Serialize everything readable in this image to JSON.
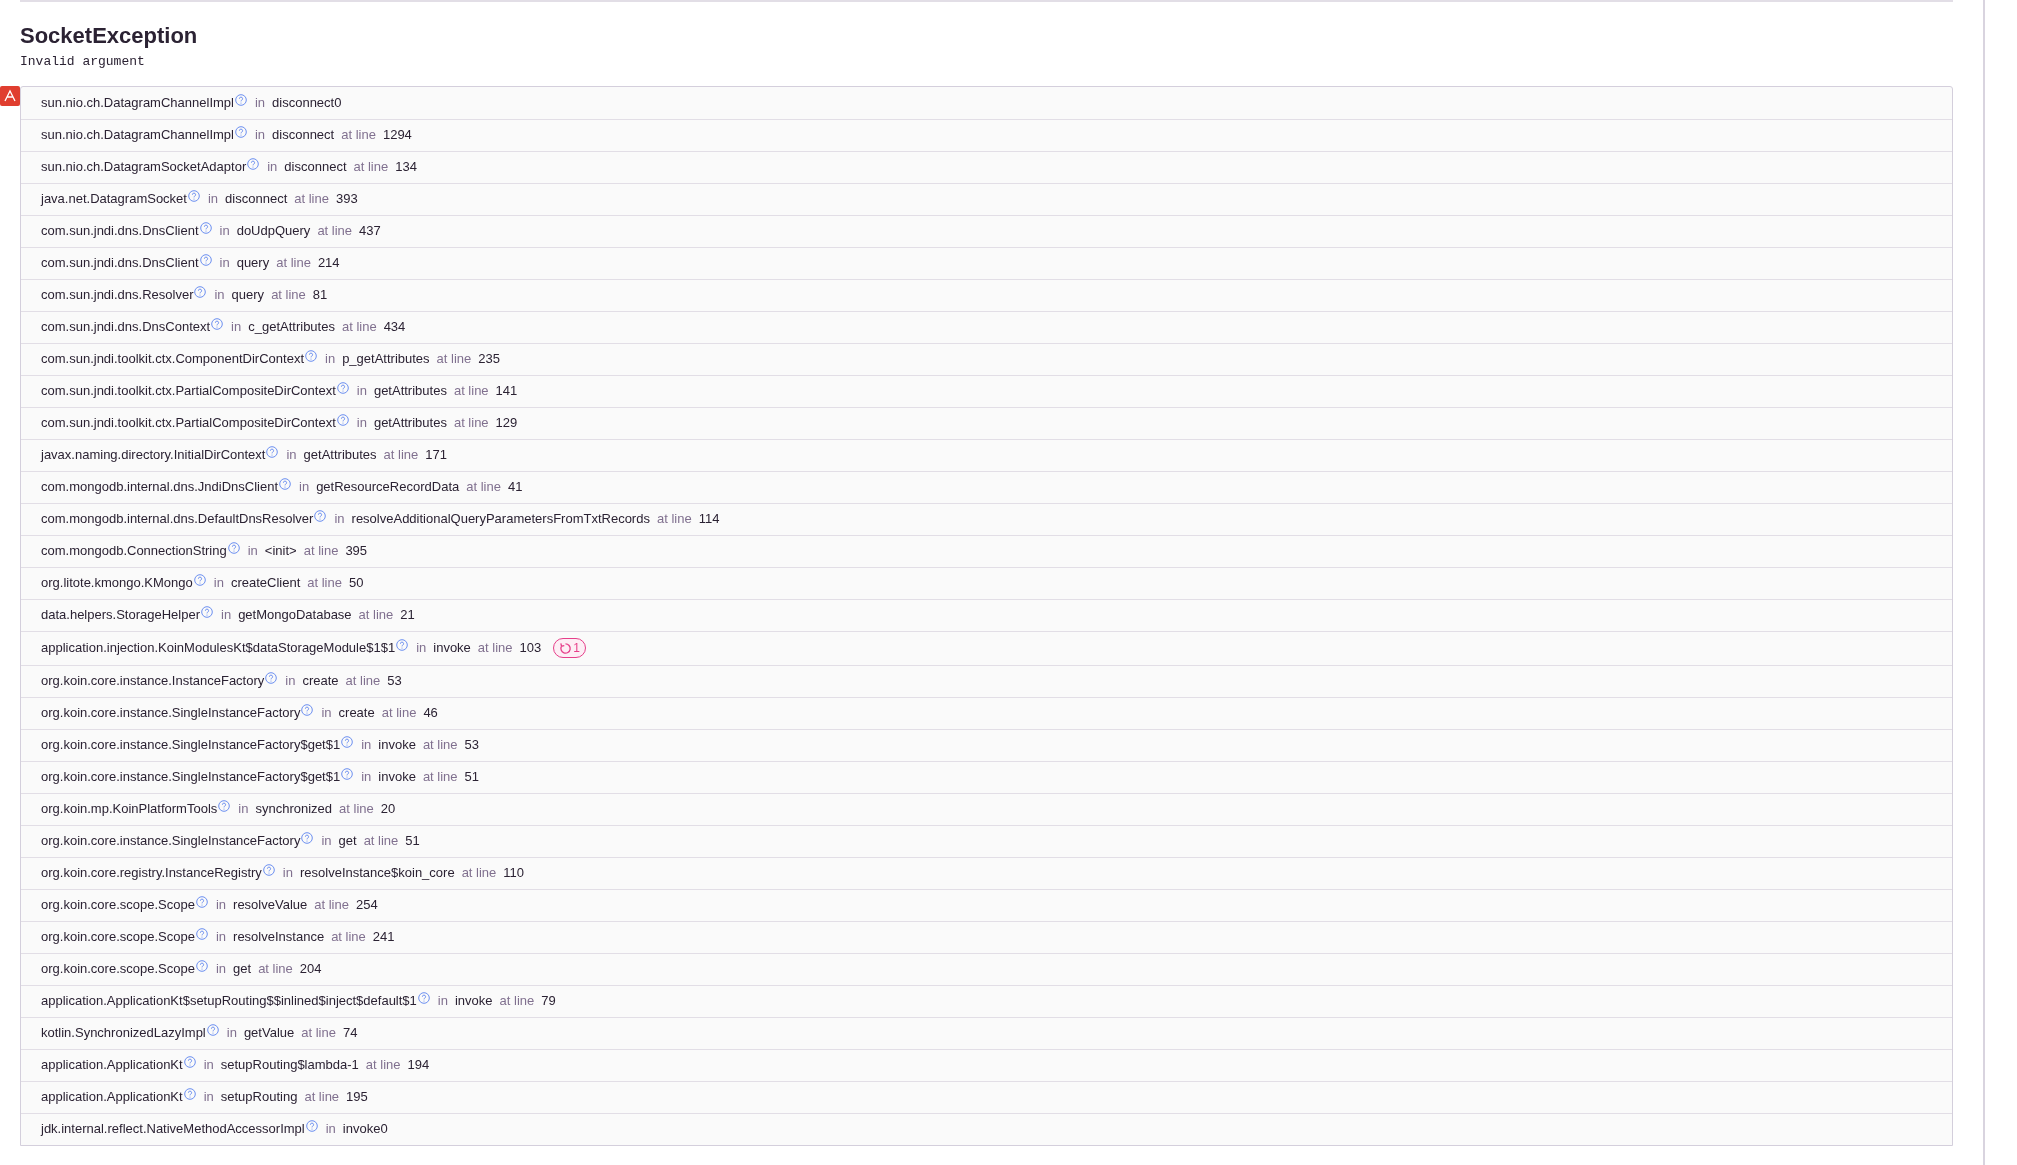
{
  "exception": {
    "type": "SocketException",
    "message": "Invalid argument"
  },
  "frames": [
    {
      "module": "sun.nio.ch.DatagramChannelImpl",
      "in": "in",
      "function": "disconnect0"
    },
    {
      "module": "sun.nio.ch.DatagramChannelImpl",
      "in": "in",
      "function": "disconnect",
      "at": "at line",
      "line": "1294"
    },
    {
      "module": "sun.nio.ch.DatagramSocketAdaptor",
      "in": "in",
      "function": "disconnect",
      "at": "at line",
      "line": "134"
    },
    {
      "module": "java.net.DatagramSocket",
      "in": "in",
      "function": "disconnect",
      "at": "at line",
      "line": "393"
    },
    {
      "module": "com.sun.jndi.dns.DnsClient",
      "in": "in",
      "function": "doUdpQuery",
      "at": "at line",
      "line": "437"
    },
    {
      "module": "com.sun.jndi.dns.DnsClient",
      "in": "in",
      "function": "query",
      "at": "at line",
      "line": "214"
    },
    {
      "module": "com.sun.jndi.dns.Resolver",
      "in": "in",
      "function": "query",
      "at": "at line",
      "line": "81"
    },
    {
      "module": "com.sun.jndi.dns.DnsContext",
      "in": "in",
      "function": "c_getAttributes",
      "at": "at line",
      "line": "434"
    },
    {
      "module": "com.sun.jndi.toolkit.ctx.ComponentDirContext",
      "in": "in",
      "function": "p_getAttributes",
      "at": "at line",
      "line": "235"
    },
    {
      "module": "com.sun.jndi.toolkit.ctx.PartialCompositeDirContext",
      "in": "in",
      "function": "getAttributes",
      "at": "at line",
      "line": "141"
    },
    {
      "module": "com.sun.jndi.toolkit.ctx.PartialCompositeDirContext",
      "in": "in",
      "function": "getAttributes",
      "at": "at line",
      "line": "129"
    },
    {
      "module": "javax.naming.directory.InitialDirContext",
      "in": "in",
      "function": "getAttributes",
      "at": "at line",
      "line": "171"
    },
    {
      "module": "com.mongodb.internal.dns.JndiDnsClient",
      "in": "in",
      "function": "getResourceRecordData",
      "at": "at line",
      "line": "41"
    },
    {
      "module": "com.mongodb.internal.dns.DefaultDnsResolver",
      "in": "in",
      "function": "resolveAdditionalQueryParametersFromTxtRecords",
      "at": "at line",
      "line": "114"
    },
    {
      "module": "com.mongodb.ConnectionString",
      "in": "in",
      "function": "<init>",
      "at": "at line",
      "line": "395"
    },
    {
      "module": "org.litote.kmongo.KMongo",
      "in": "in",
      "function": "createClient",
      "at": "at line",
      "line": "50"
    },
    {
      "module": "data.helpers.StorageHelper",
      "in": "in",
      "function": "getMongoDatabase",
      "at": "at line",
      "line": "21"
    },
    {
      "module": "application.injection.KoinModulesKt$dataStorageModule$1$1",
      "in": "in",
      "function": "invoke",
      "at": "at line",
      "line": "103",
      "repeat": "1"
    },
    {
      "module": "org.koin.core.instance.InstanceFactory",
      "in": "in",
      "function": "create",
      "at": "at line",
      "line": "53"
    },
    {
      "module": "org.koin.core.instance.SingleInstanceFactory",
      "in": "in",
      "function": "create",
      "at": "at line",
      "line": "46"
    },
    {
      "module": "org.koin.core.instance.SingleInstanceFactory$get$1",
      "in": "in",
      "function": "invoke",
      "at": "at line",
      "line": "53"
    },
    {
      "module": "org.koin.core.instance.SingleInstanceFactory$get$1",
      "in": "in",
      "function": "invoke",
      "at": "at line",
      "line": "51"
    },
    {
      "module": "org.koin.mp.KoinPlatformTools",
      "in": "in",
      "function": "synchronized",
      "at": "at line",
      "line": "20"
    },
    {
      "module": "org.koin.core.instance.SingleInstanceFactory",
      "in": "in",
      "function": "get",
      "at": "at line",
      "line": "51"
    },
    {
      "module": "org.koin.core.registry.InstanceRegistry",
      "in": "in",
      "function": "resolveInstance$koin_core",
      "at": "at line",
      "line": "110"
    },
    {
      "module": "org.koin.core.scope.Scope",
      "in": "in",
      "function": "resolveValue",
      "at": "at line",
      "line": "254"
    },
    {
      "module": "org.koin.core.scope.Scope",
      "in": "in",
      "function": "resolveInstance",
      "at": "at line",
      "line": "241"
    },
    {
      "module": "org.koin.core.scope.Scope",
      "in": "in",
      "function": "get",
      "at": "at line",
      "line": "204"
    },
    {
      "module": "application.ApplicationKt$setupRouting$$inlined$inject$default$1",
      "in": "in",
      "function": "invoke",
      "at": "at line",
      "line": "79"
    },
    {
      "module": "kotlin.SynchronizedLazyImpl",
      "in": "in",
      "function": "getValue",
      "at": "at line",
      "line": "74"
    },
    {
      "module": "application.ApplicationKt",
      "in": "in",
      "function": "setupRouting$lambda-1",
      "at": "at line",
      "line": "194"
    },
    {
      "module": "application.ApplicationKt",
      "in": "in",
      "function": "setupRouting",
      "at": "at line",
      "line": "195"
    },
    {
      "module": "jdk.internal.reflect.NativeMethodAccessorImpl",
      "in": "in",
      "function": "invoke0"
    }
  ]
}
